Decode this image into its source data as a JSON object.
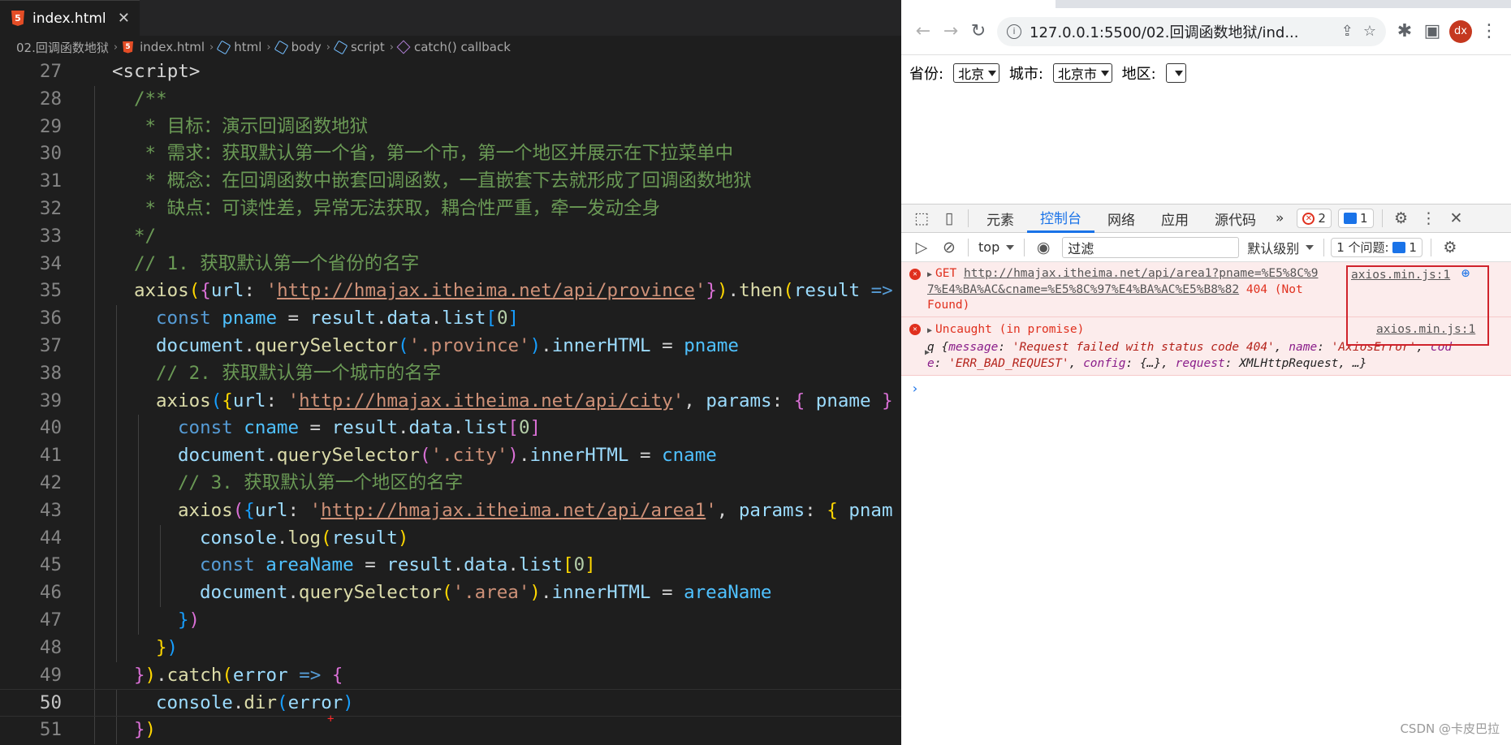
{
  "editor": {
    "tab": {
      "label": "index.html",
      "close": "✕"
    },
    "breadcrumb": [
      {
        "label": "02.回调函数地狱",
        "icon": "none"
      },
      {
        "label": "index.html",
        "icon": "html5-icon"
      },
      {
        "label": "html",
        "icon": "cube-icon"
      },
      {
        "label": "body",
        "icon": "cube-icon"
      },
      {
        "label": "script",
        "icon": "cube-icon"
      },
      {
        "label": "catch() callback",
        "icon": "symbol-icon"
      }
    ],
    "line_numbers": [
      "27",
      "28",
      "29",
      "30",
      "31",
      "32",
      "33",
      "34",
      "35",
      "36",
      "37",
      "38",
      "39",
      "40",
      "41",
      "42",
      "43",
      "44",
      "45",
      "46",
      "47",
      "48",
      "49",
      "50",
      "51"
    ],
    "code": {
      "l27": "<script>",
      "l28": "/**",
      "l29": " * 目标：演示回调函数地狱",
      "l30": " * 需求：获取默认第一个省，第一个市，第一个地区并展示在下拉菜单中",
      "l31": " * 概念：在回调函数中嵌套回调函数，一直嵌套下去就形成了回调函数地狱",
      "l32": " * 缺点：可读性差，异常无法获取，耦合性严重，牵一发动全身",
      "l33": "*/",
      "l34": "// 1. 获取默认第一个省份的名字",
      "l38": "// 2. 获取默认第一个城市的名字",
      "l42": "// 3. 获取默认第一个地区的名字",
      "url_province": "http://hmajax.itheima.net/api/province",
      "url_city": "http://hmajax.itheima.net/api/city",
      "url_area": "http://hmajax.itheima.net/api/area1"
    }
  },
  "browser": {
    "url": "127.0.0.1:5500/02.回调函数地狱/ind...",
    "avatar": "dx",
    "page": {
      "province_label": "省份:",
      "province_value": "北京",
      "city_label": "城市:",
      "city_value": "北京市",
      "area_label": "地区:",
      "area_value": ""
    },
    "devtools": {
      "tabs": [
        "元素",
        "控制台",
        "网络",
        "应用",
        "源代码"
      ],
      "active_tab": "控制台",
      "more": "»",
      "error_count": "2",
      "message_count": "1",
      "context": "top",
      "filter_placeholder": "过滤",
      "level": "默认级别",
      "issues_label": "1 个问题:",
      "issues_count": "1",
      "log1": {
        "method": "GET",
        "url_line1": "http://hmajax.itheima.net/api/area1?pname=%E5%8C%9",
        "url_line2": "7%E4%BA%AC&cname=%E5%8C%97%E4%BA%AC%E5%B8%82",
        "status": " 404 (Not",
        "status2": "Found)",
        "source": "axios.min.js:1"
      },
      "log2": {
        "title": "Uncaught (in promise)",
        "source": "axios.min.js:1",
        "obj_prefix": "q {",
        "k1": "message",
        "v1": "'Request failed with status code 404'",
        "k2": "name",
        "v2": "'AxiosError'",
        "k3": "cod",
        "k3b": "e",
        "v3": "'ERR_BAD_REQUEST'",
        "k4": "config",
        "v4": "{…}",
        "k5": "request",
        "v5": "XMLHttpRequest",
        "tail": "…}"
      },
      "prompt": "›"
    }
  },
  "watermark": "CSDN @卡皮巴拉",
  "colors": {
    "error": "#e0301e",
    "accent": "#1a73e8",
    "highlight_box": "#d0232c"
  }
}
